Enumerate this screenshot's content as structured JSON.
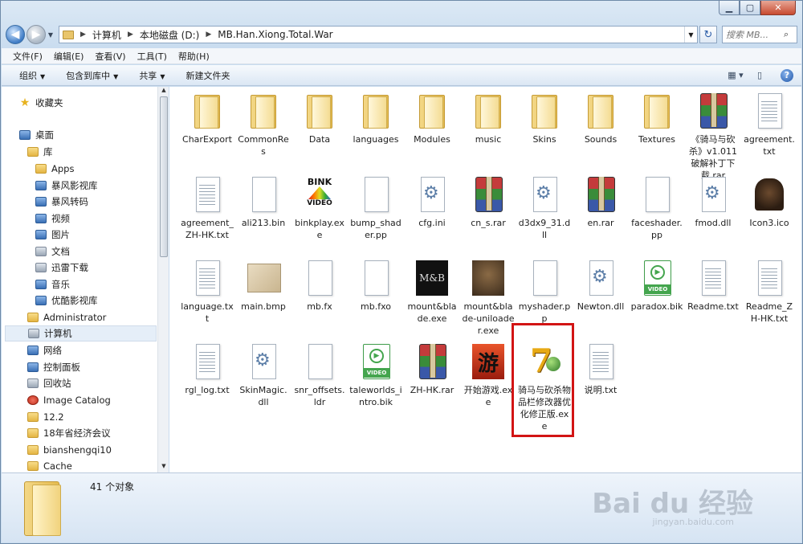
{
  "address": {
    "segments": [
      "计算机",
      "本地磁盘 (D:)",
      "MB.Han.Xiong.Total.War"
    ],
    "search_placeholder": "搜索 MB..."
  },
  "menu": [
    "文件(F)",
    "编辑(E)",
    "查看(V)",
    "工具(T)",
    "帮助(H)"
  ],
  "commands": {
    "organize": "组织",
    "include_library": "包含到库中",
    "share": "共享",
    "new_folder": "新建文件夹"
  },
  "nav": {
    "favorites": "收藏夹",
    "desktop": "桌面",
    "library": "库",
    "apps": "Apps",
    "bf_library": "暴风影视库",
    "bf_convert": "暴风转码",
    "video": "视频",
    "pictures": "图片",
    "documents": "文档",
    "xunlei": "迅雷下载",
    "music": "音乐",
    "youku": "优酷影视库",
    "administrator": "Administrator",
    "computer": "计算机",
    "network": "网络",
    "control_panel": "控制面板",
    "recycle": "回收站",
    "image_catalog": "Image Catalog",
    "f122": "12.2",
    "meeting": "18年省经济会议",
    "bsq": "bianshengqi10",
    "cache": "Cache"
  },
  "files": [
    {
      "name": "CharExport",
      "icon": "folder"
    },
    {
      "name": "CommonRes",
      "icon": "folder"
    },
    {
      "name": "Data",
      "icon": "folder"
    },
    {
      "name": "languages",
      "icon": "folder"
    },
    {
      "name": "Modules",
      "icon": "folder"
    },
    {
      "name": "music",
      "icon": "folder"
    },
    {
      "name": "Skins",
      "icon": "folder"
    },
    {
      "name": "Sounds",
      "icon": "folder"
    },
    {
      "name": "Textures",
      "icon": "folder"
    },
    {
      "name": "《骑马与砍杀》v1.011破解补丁下载.rar",
      "icon": "rar"
    },
    {
      "name": "agreement.txt",
      "icon": "txt"
    },
    {
      "name": "agreement_ZH-HK.txt",
      "icon": "txt"
    },
    {
      "name": "ali213.bin",
      "icon": "doc"
    },
    {
      "name": "binkplay.exe",
      "icon": "bink"
    },
    {
      "name": "bump_shader.pp",
      "icon": "doc"
    },
    {
      "name": "cfg.ini",
      "icon": "gear"
    },
    {
      "name": "cn_s.rar",
      "icon": "rar"
    },
    {
      "name": "d3dx9_31.dll",
      "icon": "gear"
    },
    {
      "name": "en.rar",
      "icon": "rar"
    },
    {
      "name": "faceshader.pp",
      "icon": "doc"
    },
    {
      "name": "fmod.dll",
      "icon": "gear"
    },
    {
      "name": "Icon3.ico",
      "icon": "knight"
    },
    {
      "name": "language.txt",
      "icon": "txt"
    },
    {
      "name": "main.bmp",
      "icon": "bmp"
    },
    {
      "name": "mb.fx",
      "icon": "doc"
    },
    {
      "name": "mb.fxo",
      "icon": "doc"
    },
    {
      "name": "mount&blade.exe",
      "icon": "mb"
    },
    {
      "name": "mount&blade-uniloader.exe",
      "icon": "photo"
    },
    {
      "name": "myshader.pp",
      "icon": "doc"
    },
    {
      "name": "Newton.dll",
      "icon": "gear"
    },
    {
      "name": "paradox.bik",
      "icon": "video"
    },
    {
      "name": "Readme.txt",
      "icon": "txt"
    },
    {
      "name": "Readme_ZH-HK.txt",
      "icon": "txt"
    },
    {
      "name": "rgl_log.txt",
      "icon": "txt"
    },
    {
      "name": "SkinMagic.dll",
      "icon": "gear"
    },
    {
      "name": "snr_offsets.ldr",
      "icon": "doc"
    },
    {
      "name": "taleworlds_intro.bik",
      "icon": "video"
    },
    {
      "name": "ZH-HK.rar",
      "icon": "rar"
    },
    {
      "name": "开始游戏.exe",
      "icon": "game"
    },
    {
      "name": "骑马与砍杀物品栏修改器优化修正版.exe",
      "icon": "seven"
    },
    {
      "name": "说明.txt",
      "icon": "txt"
    }
  ],
  "status": {
    "count": "41 个对象"
  },
  "watermark": {
    "brand": "Bai du 经验",
    "url": "jingyan.baidu.com"
  }
}
